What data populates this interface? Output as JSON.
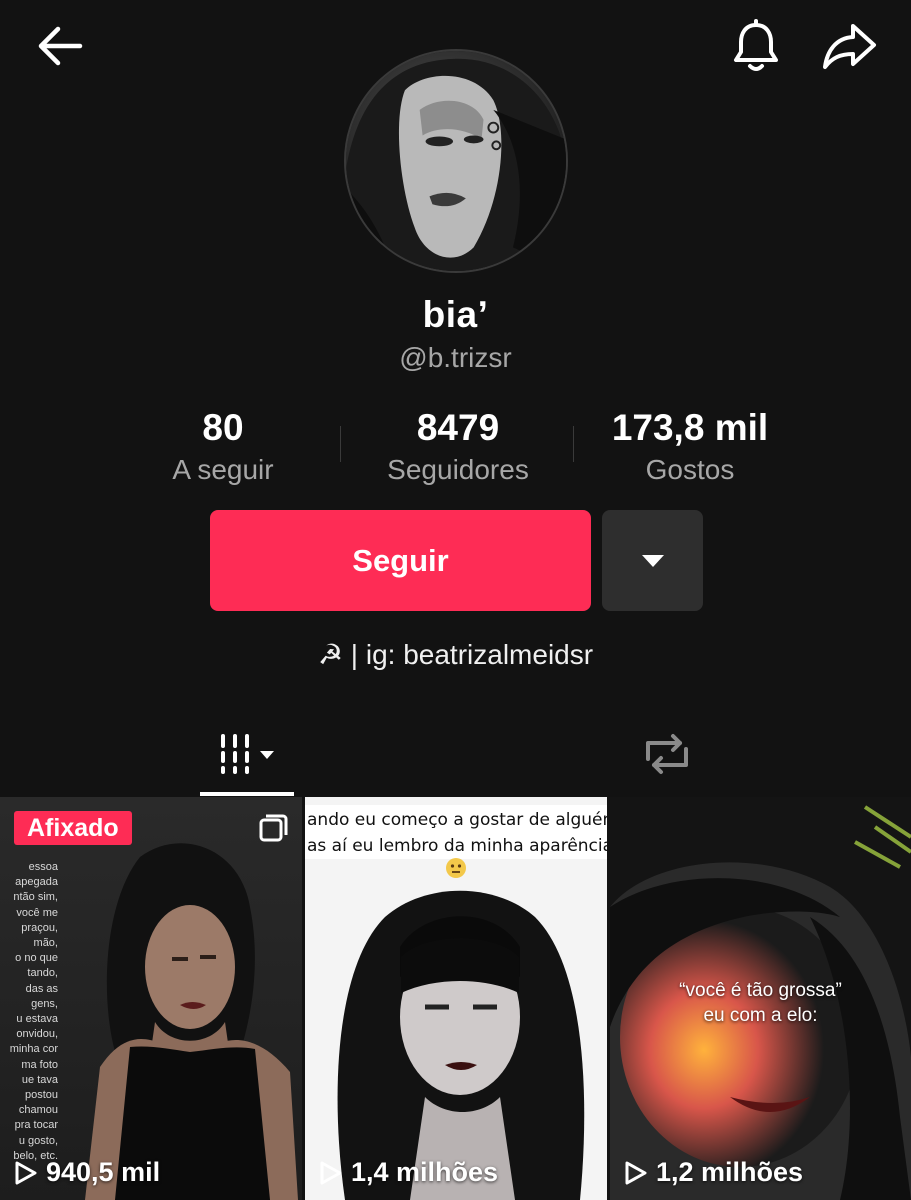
{
  "profile": {
    "display_name": "bia’",
    "handle": "@b.trizsr",
    "bio": "☭ | ig: beatrizalmeidsr"
  },
  "stats": {
    "following": {
      "value": "80",
      "label": "A seguir"
    },
    "followers": {
      "value": "8479",
      "label": "Seguidores"
    },
    "likes": {
      "value": "173,8 mil",
      "label": "Gostos"
    }
  },
  "actions": {
    "follow_label": "Seguir"
  },
  "videos": [
    {
      "pinned_label": "Afixado",
      "views": "940,5 mil",
      "side_text": [
        "essoa",
        "apegada",
        "ntão sim,",
        "você me",
        "praçou,",
        "mão,",
        "o no que",
        "tando,",
        "das as",
        "gens,",
        "u estava",
        "onvidou,",
        "minha cor",
        "ma foto",
        "ue tava",
        "postou",
        "chamou",
        "pra tocar",
        "u gosto,",
        "belo, etc."
      ]
    },
    {
      "caption_line1": "ando eu começo a gostar de alguém",
      "caption_line2": "as aí eu lembro da minha aparência",
      "views": "1,4 milhões"
    },
    {
      "overlay_line1": "“você é tão grossa”",
      "overlay_line2": "eu com a elo:",
      "views": "1,2 milhões"
    }
  ],
  "colors": {
    "background": "#121212",
    "accent": "#fe2c55",
    "secondary_text": "#a7a7a7",
    "secondary_button": "#2e2e2e"
  },
  "icons": {
    "back": "back-arrow-icon",
    "bell": "bell-icon",
    "share": "share-icon",
    "dropdown": "caret-down-icon",
    "videos_tab": "videos-grid-icon",
    "reposts_tab": "repost-icon",
    "play": "play-icon",
    "multi": "multi-photo-icon"
  }
}
